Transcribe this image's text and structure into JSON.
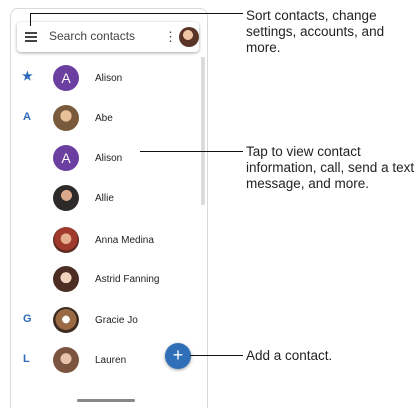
{
  "search": {
    "placeholder": "Search contacts",
    "menu_glyph": "⋮"
  },
  "contacts": [
    {
      "section": "★",
      "name": "Alison",
      "avatar_letter": "A"
    },
    {
      "section": "A",
      "name": "Abe"
    },
    {
      "section": "",
      "name": "Alison",
      "avatar_letter": "A"
    },
    {
      "section": "",
      "name": "Allie"
    },
    {
      "section": "",
      "name": "Anna Medina"
    },
    {
      "section": "",
      "name": "Astrid Fanning"
    },
    {
      "section": "G",
      "name": "Gracie Jo"
    },
    {
      "section": "L",
      "name": "Lauren"
    }
  ],
  "fab": {
    "glyph": "+"
  },
  "callouts": {
    "menu": "Sort contacts, change settings, accounts, and more.",
    "contact": "Tap to view contact information, call, send a text message, and more.",
    "add": "Add a contact."
  },
  "colors": {
    "accent": "#2f6fb7",
    "section_letter": "#2d6ab8",
    "letter_avatar": "#6a3fa0"
  }
}
